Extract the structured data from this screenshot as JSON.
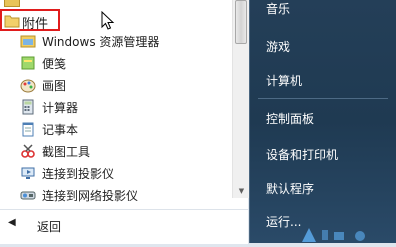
{
  "left": {
    "folder": {
      "label": "附件"
    },
    "items": [
      {
        "label": "Windows 资源管理器",
        "icon": "explorer-icon"
      },
      {
        "label": "便笺",
        "icon": "sticky-notes-icon"
      },
      {
        "label": "画图",
        "icon": "paint-icon"
      },
      {
        "label": "计算器",
        "icon": "calculator-icon"
      },
      {
        "label": "记事本",
        "icon": "notepad-icon"
      },
      {
        "label": "截图工具",
        "icon": "snipping-tool-icon"
      },
      {
        "label": "连接到投影仪",
        "icon": "projector-icon"
      },
      {
        "label": "连接到网络投影仪",
        "icon": "network-projector-icon"
      }
    ],
    "back_label": "返回"
  },
  "right": {
    "items": [
      {
        "label": "音乐"
      },
      {
        "label": "游戏"
      },
      {
        "label": "计算机"
      },
      {
        "label": "控制面板"
      },
      {
        "label": "设备和打印机"
      },
      {
        "label": "默认程序"
      },
      {
        "label": "运行..."
      }
    ]
  },
  "colors": {
    "highlight_border": "#e01c1c",
    "right_pane_bg": "#243f58"
  }
}
